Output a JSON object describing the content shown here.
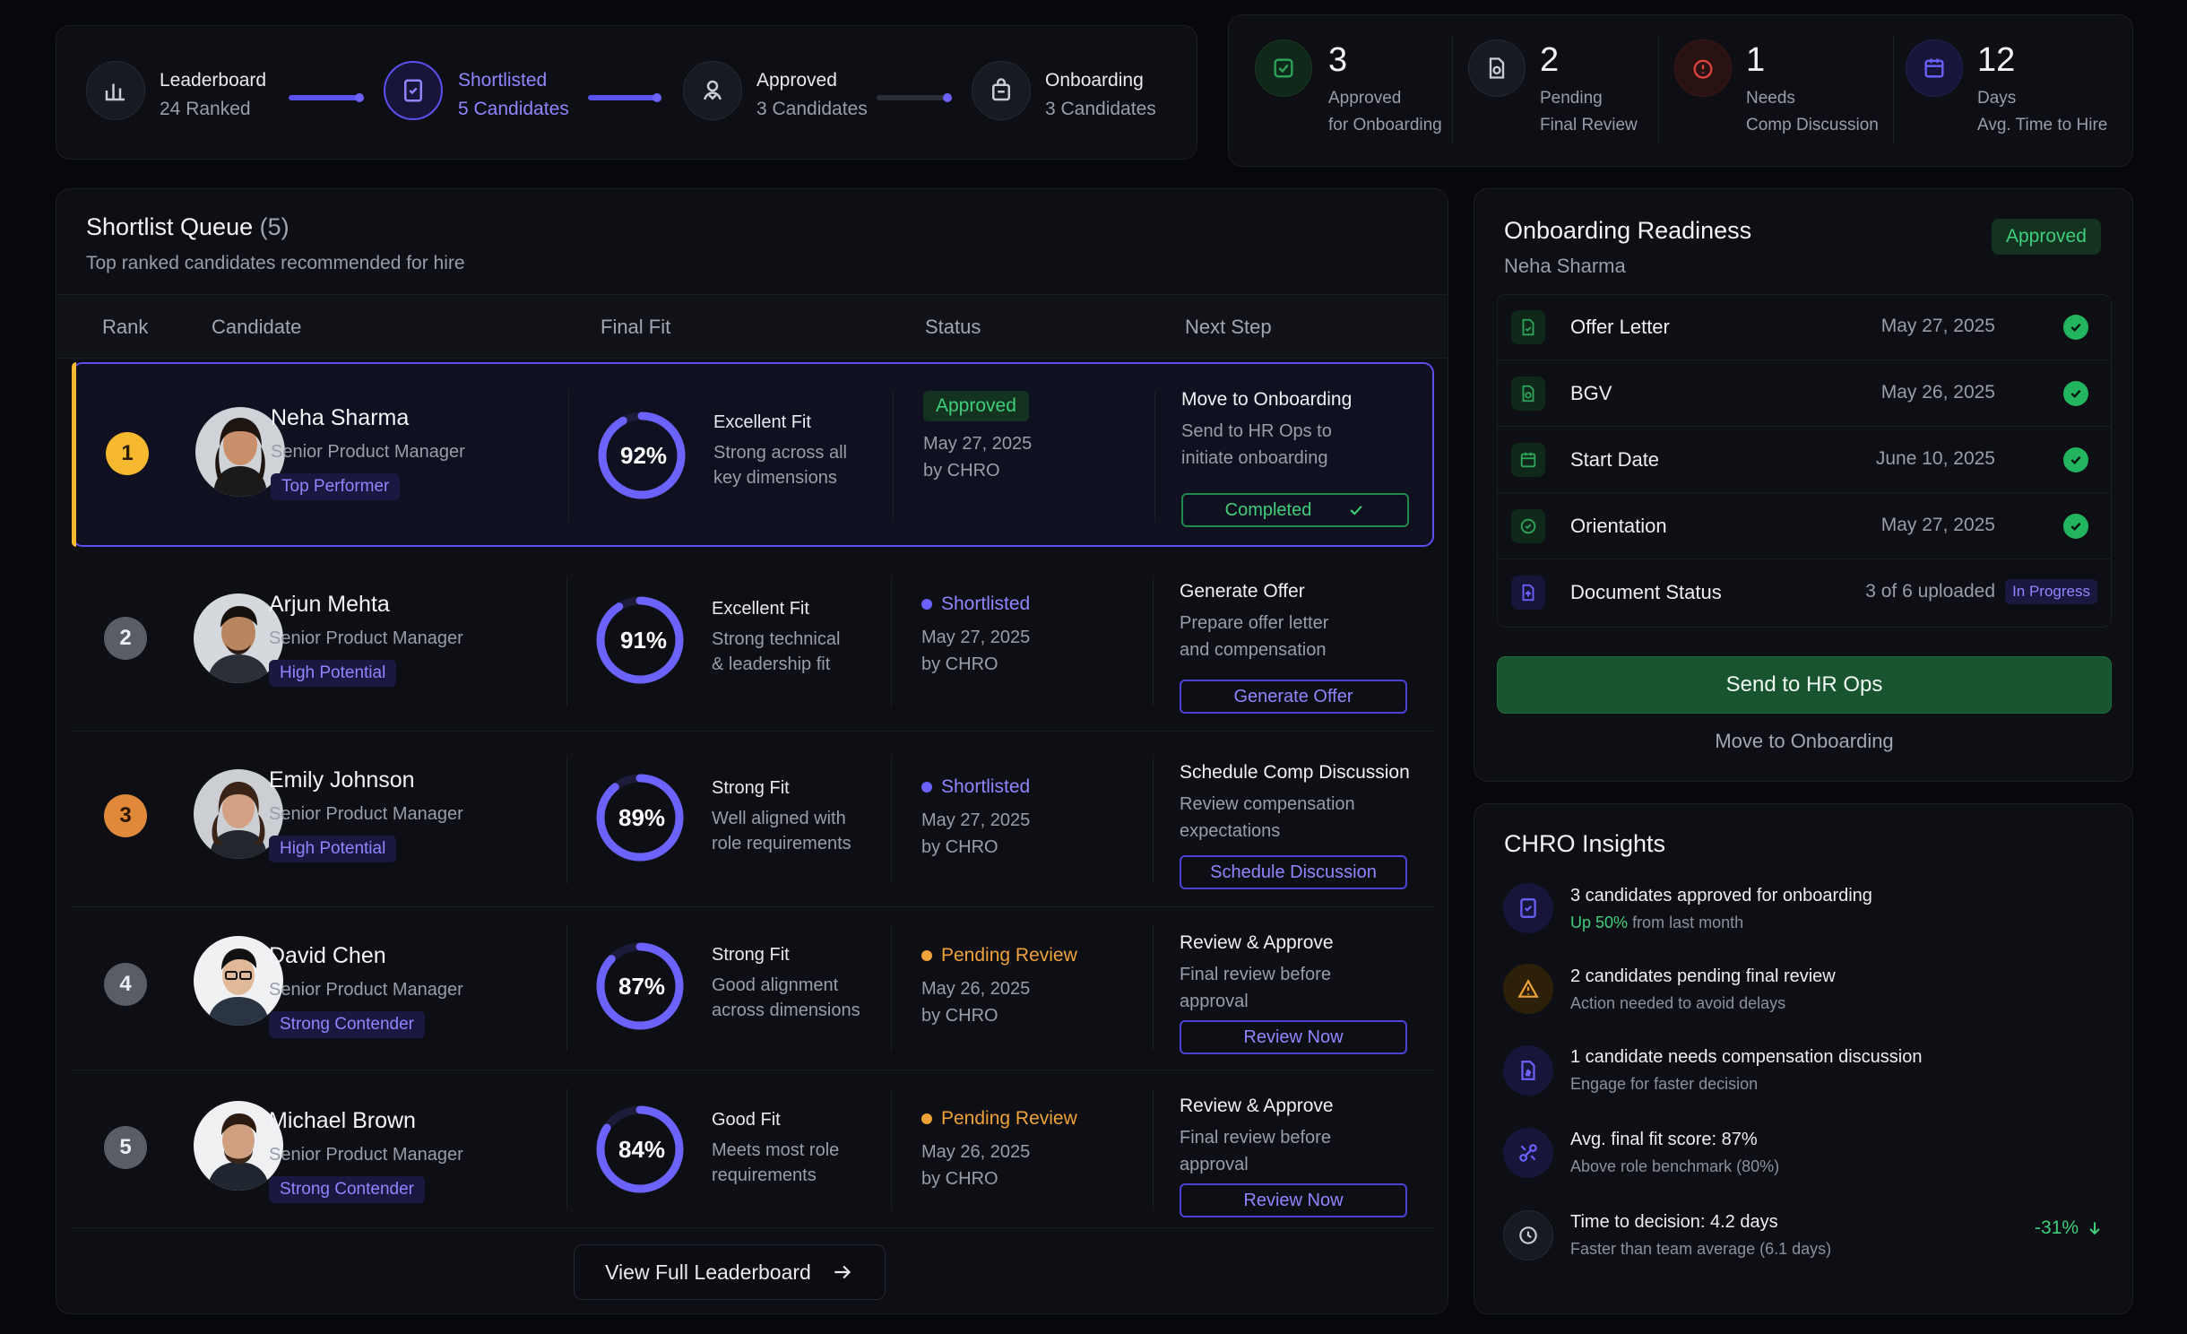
{
  "stepper": [
    {
      "title": "Leaderboard",
      "sub": "24 Ranked"
    },
    {
      "title": "Shortlisted",
      "sub": "5 Candidates"
    },
    {
      "title": "Approved",
      "sub": "3 Candidates"
    },
    {
      "title": "Onboarding",
      "sub": "3 Candidates"
    }
  ],
  "kpis": [
    {
      "num": "3",
      "l1": "Approved",
      "l2": "for Onboarding",
      "icon": "approved-check-icon",
      "color": "#2ea55a"
    },
    {
      "num": "2",
      "l1": "Pending",
      "l2": "Final Review",
      "icon": "document-review-icon",
      "color": "#9a9caa"
    },
    {
      "num": "1",
      "l1": "Needs",
      "l2": "Comp Discussion",
      "icon": "alert-icon",
      "color": "#e0433e"
    },
    {
      "num": "12",
      "l1": "Days",
      "l2": "Avg. Time to Hire",
      "icon": "calendar-icon",
      "color": "#6c63ff"
    }
  ],
  "queue": {
    "title": "Shortlist Queue",
    "count": "(5)",
    "subtitle": "Top ranked candidates recommended for hire",
    "headers": {
      "rank": "Rank",
      "candidate": "Candidate",
      "fit": "Final Fit",
      "status": "Status",
      "next": "Next Step"
    },
    "rows": [
      {
        "rank": "1",
        "name": "Neha Sharma",
        "role": "Senior Product Manager",
        "tag": "Top Performer",
        "fit_pct": 92,
        "fit_label": "92%",
        "fit_title": "Excellent Fit",
        "fit_desc1": "Strong across all",
        "fit_desc2": "key dimensions",
        "status": "Approved",
        "status_date": "May 27, 2025",
        "status_by": "by CHRO",
        "ns_title": "Move to Onboarding",
        "ns_desc1": "Send to HR Ops to",
        "ns_desc2": "initiate onboarding",
        "ns_btn": "Completed"
      },
      {
        "rank": "2",
        "name": "Arjun Mehta",
        "role": "Senior Product Manager",
        "tag": "High Potential",
        "fit_pct": 91,
        "fit_label": "91%",
        "fit_title": "Excellent Fit",
        "fit_desc1": "Strong technical",
        "fit_desc2": "& leadership fit",
        "status": "Shortlisted",
        "status_date": "May 27, 2025",
        "status_by": "by CHRO",
        "ns_title": "Generate Offer",
        "ns_desc1": "Prepare offer letter",
        "ns_desc2": "and compensation",
        "ns_btn": "Generate Offer"
      },
      {
        "rank": "3",
        "name": "Emily Johnson",
        "role": "Senior Product Manager",
        "tag": "High Potential",
        "fit_pct": 89,
        "fit_label": "89%",
        "fit_title": "Strong Fit",
        "fit_desc1": "Well aligned with",
        "fit_desc2": "role requirements",
        "status": "Shortlisted",
        "status_date": "May 27, 2025",
        "status_by": "by CHRO",
        "ns_title": "Schedule Comp Discussion",
        "ns_desc1": "Review compensation",
        "ns_desc2": "expectations",
        "ns_btn": "Schedule Discussion"
      },
      {
        "rank": "4",
        "name": "David Chen",
        "role": "Senior Product Manager",
        "tag": "Strong Contender",
        "fit_pct": 87,
        "fit_label": "87%",
        "fit_title": "Strong Fit",
        "fit_desc1": "Good alignment",
        "fit_desc2": "across dimensions",
        "status": "Pending Review",
        "status_date": "May 26, 2025",
        "status_by": "by CHRO",
        "ns_title": "Review & Approve",
        "ns_desc1": "Final review before",
        "ns_desc2": "approval",
        "ns_btn": "Review Now"
      },
      {
        "rank": "5",
        "name": "Michael Brown",
        "role": "Senior Product Manager",
        "tag": "Strong Contender",
        "fit_pct": 84,
        "fit_label": "84%",
        "fit_title": "Good Fit",
        "fit_desc1": "Meets most role",
        "fit_desc2": "requirements",
        "status": "Pending Review",
        "status_date": "May 26, 2025",
        "status_by": "by CHRO",
        "ns_title": "Review & Approve",
        "ns_desc1": "Final review before",
        "ns_desc2": "approval",
        "ns_btn": "Review Now"
      }
    ],
    "view_full": "View Full Leaderboard"
  },
  "readiness": {
    "title": "Onboarding Readiness",
    "badge": "Approved",
    "name": "Neha Sharma",
    "items": [
      {
        "label": "Offer Letter",
        "date": "May 27, 2025"
      },
      {
        "label": "BGV",
        "date": "May 26, 2025"
      },
      {
        "label": "Start Date",
        "date": "June 10, 2025"
      },
      {
        "label": "Orientation",
        "date": "May 27, 2025"
      },
      {
        "label": "Document Status",
        "date": "3 of 6 uploaded",
        "badge": "In Progress"
      }
    ],
    "primary_btn": "Send to HR Ops",
    "secondary_btn": "Move to Onboarding"
  },
  "insights": {
    "title": "CHRO Insights",
    "items": [
      {
        "title": "3 candidates approved for onboarding",
        "sub_hl": "Up 50%",
        "sub": "from last month"
      },
      {
        "title": "2 candidates pending final review",
        "sub": "Action needed to avoid delays"
      },
      {
        "title": "1 candidate needs compensation discussion",
        "sub": "Engage for faster decision"
      },
      {
        "title": "Avg. final fit score: 87%",
        "sub": "Above role benchmark (80%)"
      },
      {
        "title": "Time to decision: 4.2 days",
        "sub": "Faster than team average (6.1 days)",
        "delta": "-31%"
      }
    ]
  },
  "colors": {
    "accent": "#6c63ff",
    "green": "#3fcf7c",
    "orange": "#f0a23a"
  }
}
